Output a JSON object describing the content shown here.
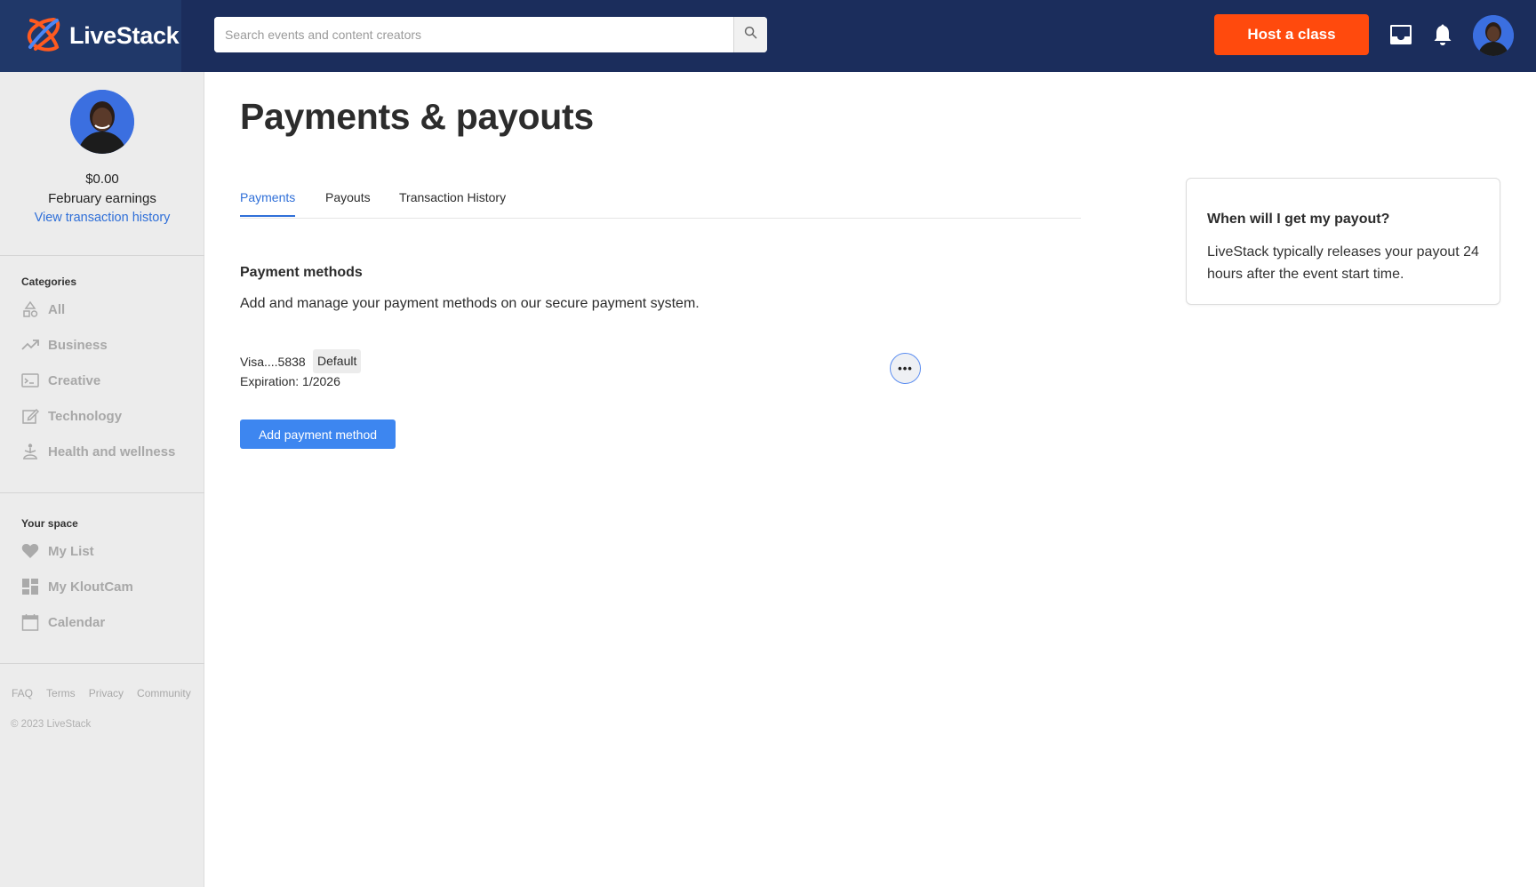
{
  "header": {
    "brand_name": "LiveStack",
    "search_placeholder": "Search events and content creators",
    "host_button_label": "Host a class"
  },
  "sidebar": {
    "earnings_amount": "$0.00",
    "earnings_label": "February earnings",
    "view_history_link": "View transaction history",
    "categories_heading": "Categories",
    "categories": [
      {
        "label": "All",
        "icon": "shapes-icon"
      },
      {
        "label": "Business",
        "icon": "trending-up-icon"
      },
      {
        "label": "Creative",
        "icon": "terminal-icon"
      },
      {
        "label": "Technology",
        "icon": "edit-icon"
      },
      {
        "label": "Health and wellness",
        "icon": "meditation-icon"
      }
    ],
    "space_heading": "Your space",
    "space_items": [
      {
        "label": "My List",
        "icon": "heart-icon"
      },
      {
        "label": "My KloutCam",
        "icon": "dashboard-icon"
      },
      {
        "label": "Calendar",
        "icon": "calendar-icon"
      }
    ],
    "footer_links": [
      "FAQ",
      "Terms",
      "Privacy",
      "Community"
    ],
    "copyright": "© 2023 LiveStack"
  },
  "main": {
    "page_title": "Payments & payouts",
    "tabs": [
      {
        "label": "Payments",
        "active": true
      },
      {
        "label": "Payouts",
        "active": false
      },
      {
        "label": "Transaction History",
        "active": false
      }
    ],
    "payment_methods_title": "Payment methods",
    "payment_methods_desc": "Add and manage your payment methods on our secure payment system.",
    "card": {
      "number": "Visa....5838",
      "badge": "Default",
      "expiration": "Expiration: 1/2026",
      "more_label": "•••"
    },
    "add_button_label": "Add payment method"
  },
  "info_card": {
    "title": "When will I get my payout?",
    "body": "LiveStack typically releases your payout 24 hours after the event start time."
  },
  "colors": {
    "header_bg": "#1b2d5c",
    "accent_orange": "#ff4a0d",
    "accent_blue": "#2f6fd8",
    "button_blue": "#3d86f0"
  }
}
